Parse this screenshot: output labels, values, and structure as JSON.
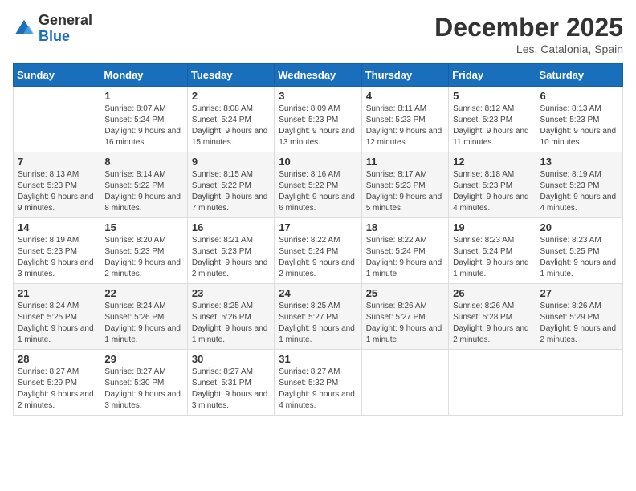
{
  "header": {
    "logo_general": "General",
    "logo_blue": "Blue",
    "title": "December 2025",
    "location": "Les, Catalonia, Spain"
  },
  "days_of_week": [
    "Sunday",
    "Monday",
    "Tuesday",
    "Wednesday",
    "Thursday",
    "Friday",
    "Saturday"
  ],
  "weeks": [
    [
      {
        "day": "",
        "sunrise": "",
        "sunset": "",
        "daylight": ""
      },
      {
        "day": "1",
        "sunrise": "Sunrise: 8:07 AM",
        "sunset": "Sunset: 5:24 PM",
        "daylight": "Daylight: 9 hours and 16 minutes."
      },
      {
        "day": "2",
        "sunrise": "Sunrise: 8:08 AM",
        "sunset": "Sunset: 5:24 PM",
        "daylight": "Daylight: 9 hours and 15 minutes."
      },
      {
        "day": "3",
        "sunrise": "Sunrise: 8:09 AM",
        "sunset": "Sunset: 5:23 PM",
        "daylight": "Daylight: 9 hours and 13 minutes."
      },
      {
        "day": "4",
        "sunrise": "Sunrise: 8:11 AM",
        "sunset": "Sunset: 5:23 PM",
        "daylight": "Daylight: 9 hours and 12 minutes."
      },
      {
        "day": "5",
        "sunrise": "Sunrise: 8:12 AM",
        "sunset": "Sunset: 5:23 PM",
        "daylight": "Daylight: 9 hours and 11 minutes."
      },
      {
        "day": "6",
        "sunrise": "Sunrise: 8:13 AM",
        "sunset": "Sunset: 5:23 PM",
        "daylight": "Daylight: 9 hours and 10 minutes."
      }
    ],
    [
      {
        "day": "7",
        "sunrise": "Sunrise: 8:13 AM",
        "sunset": "Sunset: 5:23 PM",
        "daylight": "Daylight: 9 hours and 9 minutes."
      },
      {
        "day": "8",
        "sunrise": "Sunrise: 8:14 AM",
        "sunset": "Sunset: 5:22 PM",
        "daylight": "Daylight: 9 hours and 8 minutes."
      },
      {
        "day": "9",
        "sunrise": "Sunrise: 8:15 AM",
        "sunset": "Sunset: 5:22 PM",
        "daylight": "Daylight: 9 hours and 7 minutes."
      },
      {
        "day": "10",
        "sunrise": "Sunrise: 8:16 AM",
        "sunset": "Sunset: 5:22 PM",
        "daylight": "Daylight: 9 hours and 6 minutes."
      },
      {
        "day": "11",
        "sunrise": "Sunrise: 8:17 AM",
        "sunset": "Sunset: 5:23 PM",
        "daylight": "Daylight: 9 hours and 5 minutes."
      },
      {
        "day": "12",
        "sunrise": "Sunrise: 8:18 AM",
        "sunset": "Sunset: 5:23 PM",
        "daylight": "Daylight: 9 hours and 4 minutes."
      },
      {
        "day": "13",
        "sunrise": "Sunrise: 8:19 AM",
        "sunset": "Sunset: 5:23 PM",
        "daylight": "Daylight: 9 hours and 4 minutes."
      }
    ],
    [
      {
        "day": "14",
        "sunrise": "Sunrise: 8:19 AM",
        "sunset": "Sunset: 5:23 PM",
        "daylight": "Daylight: 9 hours and 3 minutes."
      },
      {
        "day": "15",
        "sunrise": "Sunrise: 8:20 AM",
        "sunset": "Sunset: 5:23 PM",
        "daylight": "Daylight: 9 hours and 2 minutes."
      },
      {
        "day": "16",
        "sunrise": "Sunrise: 8:21 AM",
        "sunset": "Sunset: 5:23 PM",
        "daylight": "Daylight: 9 hours and 2 minutes."
      },
      {
        "day": "17",
        "sunrise": "Sunrise: 8:22 AM",
        "sunset": "Sunset: 5:24 PM",
        "daylight": "Daylight: 9 hours and 2 minutes."
      },
      {
        "day": "18",
        "sunrise": "Sunrise: 8:22 AM",
        "sunset": "Sunset: 5:24 PM",
        "daylight": "Daylight: 9 hours and 1 minute."
      },
      {
        "day": "19",
        "sunrise": "Sunrise: 8:23 AM",
        "sunset": "Sunset: 5:24 PM",
        "daylight": "Daylight: 9 hours and 1 minute."
      },
      {
        "day": "20",
        "sunrise": "Sunrise: 8:23 AM",
        "sunset": "Sunset: 5:25 PM",
        "daylight": "Daylight: 9 hours and 1 minute."
      }
    ],
    [
      {
        "day": "21",
        "sunrise": "Sunrise: 8:24 AM",
        "sunset": "Sunset: 5:25 PM",
        "daylight": "Daylight: 9 hours and 1 minute."
      },
      {
        "day": "22",
        "sunrise": "Sunrise: 8:24 AM",
        "sunset": "Sunset: 5:26 PM",
        "daylight": "Daylight: 9 hours and 1 minute."
      },
      {
        "day": "23",
        "sunrise": "Sunrise: 8:25 AM",
        "sunset": "Sunset: 5:26 PM",
        "daylight": "Daylight: 9 hours and 1 minute."
      },
      {
        "day": "24",
        "sunrise": "Sunrise: 8:25 AM",
        "sunset": "Sunset: 5:27 PM",
        "daylight": "Daylight: 9 hours and 1 minute."
      },
      {
        "day": "25",
        "sunrise": "Sunrise: 8:26 AM",
        "sunset": "Sunset: 5:27 PM",
        "daylight": "Daylight: 9 hours and 1 minute."
      },
      {
        "day": "26",
        "sunrise": "Sunrise: 8:26 AM",
        "sunset": "Sunset: 5:28 PM",
        "daylight": "Daylight: 9 hours and 2 minutes."
      },
      {
        "day": "27",
        "sunrise": "Sunrise: 8:26 AM",
        "sunset": "Sunset: 5:29 PM",
        "daylight": "Daylight: 9 hours and 2 minutes."
      }
    ],
    [
      {
        "day": "28",
        "sunrise": "Sunrise: 8:27 AM",
        "sunset": "Sunset: 5:29 PM",
        "daylight": "Daylight: 9 hours and 2 minutes."
      },
      {
        "day": "29",
        "sunrise": "Sunrise: 8:27 AM",
        "sunset": "Sunset: 5:30 PM",
        "daylight": "Daylight: 9 hours and 3 minutes."
      },
      {
        "day": "30",
        "sunrise": "Sunrise: 8:27 AM",
        "sunset": "Sunset: 5:31 PM",
        "daylight": "Daylight: 9 hours and 3 minutes."
      },
      {
        "day": "31",
        "sunrise": "Sunrise: 8:27 AM",
        "sunset": "Sunset: 5:32 PM",
        "daylight": "Daylight: 9 hours and 4 minutes."
      },
      {
        "day": "",
        "sunrise": "",
        "sunset": "",
        "daylight": ""
      },
      {
        "day": "",
        "sunrise": "",
        "sunset": "",
        "daylight": ""
      },
      {
        "day": "",
        "sunrise": "",
        "sunset": "",
        "daylight": ""
      }
    ]
  ]
}
